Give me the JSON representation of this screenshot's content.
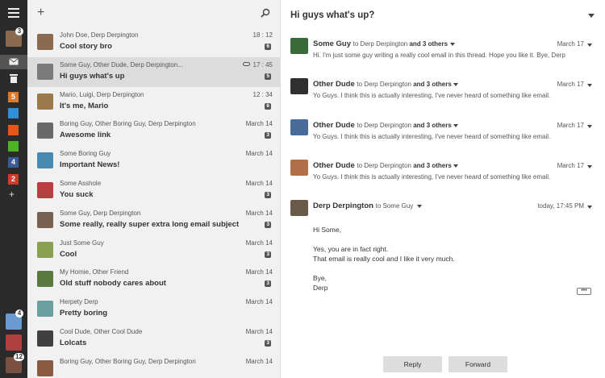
{
  "rail": {
    "top_badge": "3",
    "bottom_badges": [
      "4",
      "",
      "12"
    ],
    "folder_badges": [
      {
        "label": "5",
        "color": "#e8761c"
      },
      {
        "label": "",
        "color": "#2f8fd9"
      },
      {
        "label": "",
        "color": "#e8561c"
      },
      {
        "label": "",
        "color": "#4cb424"
      },
      {
        "label": "4",
        "color": "#3b5a9a"
      },
      {
        "label": "2",
        "color": "#d23b2b"
      }
    ],
    "add_label": "+"
  },
  "list": {
    "new_label": "+",
    "items": [
      {
        "from": "John Doe, Derp Derpington",
        "subject": "Cool story bro",
        "time": "18 : 12",
        "count": "6",
        "avatar": "#8a6a50"
      },
      {
        "from": "Some Guy, Other Dude, Derp Derpington...",
        "subject": "Hi guys what's up",
        "time": "17 : 45",
        "count": "5",
        "avatar": "#7a7a7a"
      },
      {
        "from": "Mario, Luigi, Derp Derpington",
        "subject": "It's me, Mario",
        "time": "12 : 34",
        "count": "6",
        "avatar": "#9a7a4a"
      },
      {
        "from": "Boring Guy, Other Boring Guy, Derp Derpington",
        "subject": "Awesome link",
        "time": "March 14",
        "count": "3",
        "avatar": "#6a6a6a"
      },
      {
        "from": "Some Boring Guy",
        "subject": "Important News!",
        "time": "March 14",
        "count": "",
        "avatar": "#4a8ab0"
      },
      {
        "from": "Some Asshole",
        "subject": "You suck",
        "time": "March 14",
        "count": "3",
        "avatar": "#b84040"
      },
      {
        "from": "Some Guy, Derp Derpington",
        "subject": "Some really, really super extra long email subject",
        "time": "March 14",
        "count": "3",
        "avatar": "#7a6050"
      },
      {
        "from": "Just Some Guy",
        "subject": "Cool",
        "time": "March 14",
        "count": "3",
        "avatar": "#8aa050"
      },
      {
        "from": "My Homie, Other Friend",
        "subject": "Old stuff nobody cares about",
        "time": "March 14",
        "count": "3",
        "avatar": "#5a7a40"
      },
      {
        "from": "Herpety Derp",
        "subject": "Pretty boring",
        "time": "March 14",
        "count": "",
        "avatar": "#6aa0a0"
      },
      {
        "from": "Cool Dude, Other Cool Dude",
        "subject": "Lolcats",
        "time": "March 14",
        "count": "3",
        "avatar": "#404040"
      },
      {
        "from": "Boring Guy, Other Boring Guy, Derp Derpington",
        "subject": "",
        "time": "March 14",
        "count": "",
        "avatar": "#8a5a40"
      }
    ]
  },
  "thread": {
    "title": "Hi guys what's up?",
    "messages": [
      {
        "sender": "Some Guy",
        "to": "to Derp Derpington",
        "others": "and 3 others",
        "date": "March 17",
        "snippet": "Hi. I'm just some guy writing a really cool email in this thread. Hope you like it. Bye, Derp",
        "avatar": "#3a6a3a"
      },
      {
        "sender": "Other Dude",
        "to": "to Derp Derpington",
        "others": "and 3 others",
        "date": "March 17",
        "snippet": "Yo Guys. I think this is actually interesting, I've never heard of something like email.",
        "avatar": "#303030"
      },
      {
        "sender": "Other Dude",
        "to": "to Derp Derpington",
        "others": "and 3 others",
        "date": "March 17",
        "snippet": "Yo Guys. I think this is actually interesting, I've never heard of something like email.",
        "avatar": "#4a6a9a"
      },
      {
        "sender": "Other Dude",
        "to": "to Derp Derpington",
        "others": "and 3 others",
        "date": "March 17",
        "snippet": "Yo Guys. I think this is actually interesting, I've never heard of something like email.",
        "avatar": "#b0704a"
      }
    ],
    "open_message": {
      "sender": "Derp Derpington",
      "to": "to Some Guy",
      "date": "today, 17:45 PM",
      "lines": [
        "Hi Some,",
        "",
        "Yes, you are in fact right.",
        "That email is really cool and I like it very much.",
        "",
        "Bye,",
        "Derp"
      ],
      "avatar": "#6a5a4a"
    },
    "more_label": "•••",
    "reply_label": "Reply",
    "forward_label": "Forward"
  }
}
